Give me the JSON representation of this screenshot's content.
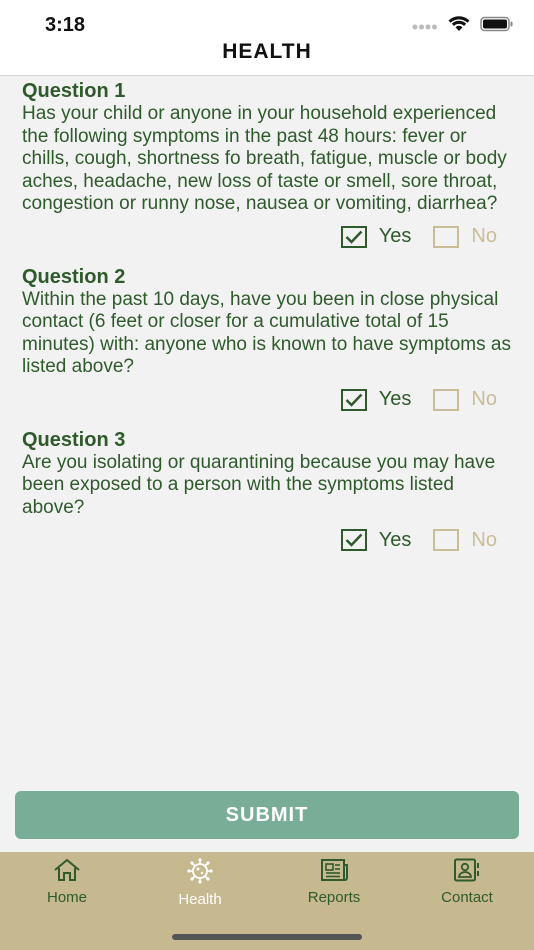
{
  "status": {
    "time": "3:18"
  },
  "header": {
    "title": "HEALTH"
  },
  "questions": [
    {
      "label": "Question 1",
      "text": "Has your child or anyone in your household experienced the following symptoms in the past 48 hours: fever or chills, cough, shortness fo breath, fatigue, muscle or body aches, headache, new loss of taste or smell, sore throat, congestion or runny nose, nausea or vomiting, diarrhea?",
      "yes": "Yes",
      "no": "No",
      "selected": "yes"
    },
    {
      "label": "Question 2",
      "text": "Within the past 10 days, have you been in close physical contact (6 feet or closer for a cumulative total of 15 minutes) with: anyone who is known to have symptoms as listed above?",
      "yes": "Yes",
      "no": "No",
      "selected": "yes"
    },
    {
      "label": "Question 3",
      "text": "Are you isolating or quarantining because you may have been exposed to a person with the symptoms listed above?",
      "yes": "Yes",
      "no": "No",
      "selected": "yes"
    }
  ],
  "submit": {
    "label": "SUBMIT"
  },
  "tabs": [
    {
      "label": "Home",
      "icon": "home-icon"
    },
    {
      "label": "Health",
      "icon": "virus-icon",
      "active": true
    },
    {
      "label": "Reports",
      "icon": "newspaper-icon"
    },
    {
      "label": "Contact",
      "icon": "contact-icon"
    }
  ],
  "colors": {
    "primary_text": "#2f5a2c",
    "submit_bg": "#7aad97",
    "tab_bar_bg": "#c6b88f",
    "unchecked": "#c9bd98"
  }
}
